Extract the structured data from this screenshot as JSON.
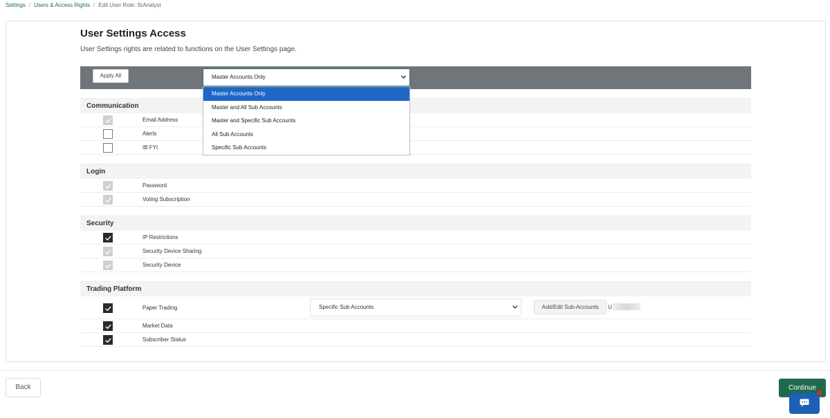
{
  "breadcrumb": {
    "items": [
      "Settings",
      "Users & Access Rights"
    ],
    "current": "Edit User Role: SrAnalyst"
  },
  "header": {
    "title": "User Settings Access",
    "subtitle": "User Settings rights are related to functions on the User Settings page."
  },
  "toolbar": {
    "apply_all_label": "Apply All",
    "scope_selected": "Master Accounts Only",
    "scope_options": [
      "Master Accounts Only",
      "Master and All Sub Accounts",
      "Master and Specific Sub Accounts",
      "All Sub Accounts",
      "Specific Sub Accounts"
    ]
  },
  "sections": [
    {
      "name": "Communication",
      "items": [
        {
          "label": "Email Address",
          "state": "checked-disabled"
        },
        {
          "label": "Alerts",
          "state": "unchecked"
        },
        {
          "label": "IB FYI",
          "state": "unchecked"
        }
      ]
    },
    {
      "name": "Login",
      "items": [
        {
          "label": "Password",
          "state": "checked-disabled"
        },
        {
          "label": "Voting Subscription",
          "state": "checked-disabled"
        }
      ]
    },
    {
      "name": "Security",
      "items": [
        {
          "label": "IP Restrictions",
          "state": "checked"
        },
        {
          "label": "Security Device Sharing",
          "state": "checked-disabled"
        },
        {
          "label": "Security Device",
          "state": "checked-disabled"
        }
      ]
    },
    {
      "name": "Trading Platform",
      "items": [
        {
          "label": "Paper Trading",
          "state": "checked"
        },
        {
          "label": "Market Data",
          "state": "checked"
        },
        {
          "label": "Subscriber Status",
          "state": "checked"
        }
      ]
    }
  ],
  "paper_trading": {
    "scope_selected": "Specific Sub Accounts",
    "add_edit_label": "Add/Edit Sub-Accounts",
    "account_prefix": "U"
  },
  "footer": {
    "back_label": "Back",
    "continue_label": "Continue"
  },
  "colors": {
    "brand_green": "#1f6a4d",
    "toolbar_gray": "#6f757b",
    "dropdown_active": "#1f66c7",
    "chat_blue": "#1d5fb5",
    "notification_red": "#e02424"
  }
}
